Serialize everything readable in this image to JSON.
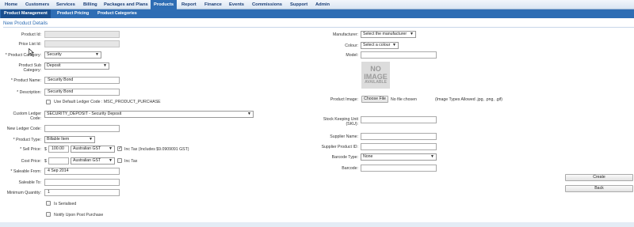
{
  "nav": {
    "items": [
      "Home",
      "Customers",
      "Services",
      "Billing",
      "Packages and Plans",
      "Products",
      "Report",
      "Finance",
      "Events",
      "Commissions",
      "Support",
      "Admin"
    ],
    "active": "Products"
  },
  "subnav": {
    "items": [
      "Product Management",
      "Product Pricing",
      "Product Categories"
    ],
    "active": "Product Management"
  },
  "section_title": "New Product Details",
  "left": {
    "product_id": {
      "label": "Product Id:",
      "value": ""
    },
    "price_list_id": {
      "label": "Price List Id:",
      "value": ""
    },
    "product_category": {
      "label": "Product Category:",
      "value": "Security"
    },
    "product_sub_category": {
      "label": "Product Sub Category:",
      "value": "Deposit"
    },
    "product_name": {
      "label": "Product Name:",
      "value": "Security Bond"
    },
    "description": {
      "label": "Description:",
      "value": "Security Bond"
    },
    "default_ledger": {
      "label": "Use Default Ledger Code : MSC_PRODUCT_PURCHASE",
      "checked": false
    },
    "custom_ledger": {
      "label": "Custom Ledger Code:",
      "value": "SECURITY_DEPOSIT - Security Deposit"
    },
    "new_ledger": {
      "label": "New Ledger Code:",
      "value": ""
    },
    "product_type": {
      "label": "Product Type:",
      "value": "Billable Item"
    },
    "sell_price": {
      "label": "Sell Price:",
      "currency_symbol": "$",
      "value": "100.00",
      "tax_region": "Australian GST",
      "inc_tax_checked": true,
      "inc_tax_label": "Inc Tax (Includes $9.0909091 GST)"
    },
    "cost_price": {
      "label": "Cost Price:",
      "currency_symbol": "$",
      "value": "",
      "tax_region": "Australian GST",
      "inc_tax_checked": false,
      "inc_tax_label": "Inc Tax"
    },
    "saleable_from": {
      "label": "Saleable From:",
      "value": "4 Sep 2014"
    },
    "saleable_to": {
      "label": "Saleable To:",
      "value": ""
    },
    "min_quantity": {
      "label": "Minimum Quantity:",
      "value": "1"
    },
    "is_serialised": {
      "label": "Is Serialised",
      "checked": false
    },
    "notify_post_purchase": {
      "label": "Notify Upon Post Purchase",
      "checked": false
    }
  },
  "right": {
    "manufacturer": {
      "label": "Manufacturer:",
      "value": "Select the manufacturer"
    },
    "colour": {
      "label": "Colour:",
      "value": "Select a colour"
    },
    "model": {
      "label": "Model:",
      "value": ""
    },
    "no_image": {
      "line1": "NO",
      "line2": "IMAGE",
      "line3": "AVAILABLE"
    },
    "product_image": {
      "label": "Product Image:",
      "button": "Choose File",
      "status": "No file chosen",
      "hint": "(Image Types Allowed .jpg, .png, .gif)"
    },
    "sku": {
      "label": "Stock Keeping Unit (SKU):",
      "value": ""
    },
    "supplier_name": {
      "label": "Supplier Name:",
      "value": ""
    },
    "supplier_product_id": {
      "label": "Supplier Product ID:",
      "value": ""
    },
    "barcode_type": {
      "label": "Barcode Type:",
      "value": "None"
    },
    "barcode": {
      "label": "Barcode:",
      "value": ""
    }
  },
  "actions": {
    "create": "Create",
    "back": "Back"
  },
  "colors": {
    "accent": "#2e6db4",
    "nav_text": "#1c3f77"
  }
}
